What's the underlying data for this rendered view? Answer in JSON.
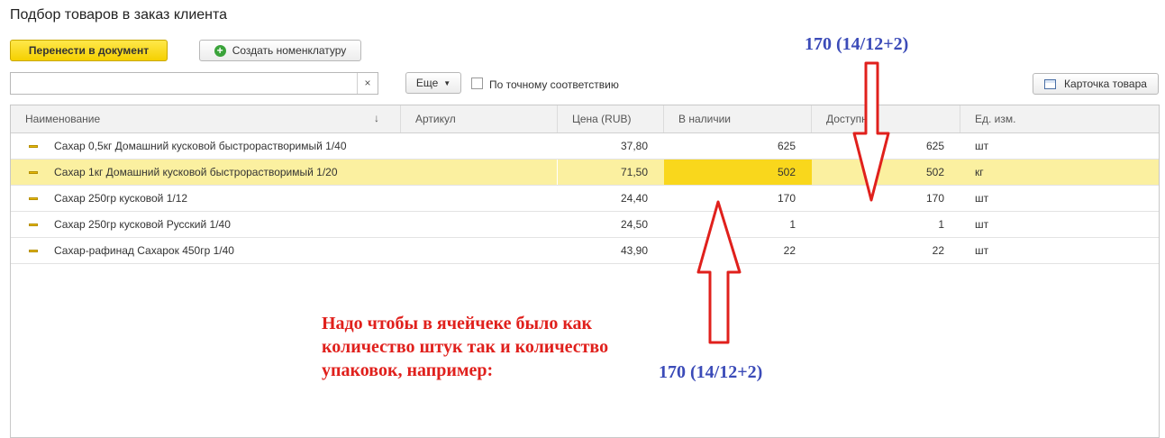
{
  "window": {
    "title": "Подбор товаров в заказ клиента"
  },
  "toolbar": {
    "transfer_label": "Перенести в документ",
    "create_label": "Создать номенклатуру",
    "more_label": "Еще",
    "exact_match_label": "По точному соответствию",
    "card_label": "Карточка товара"
  },
  "search": {
    "value": "",
    "placeholder": "",
    "clear_glyph": "×"
  },
  "table": {
    "columns": [
      "Наименование",
      "Артикул",
      "Цена (RUB)",
      "В наличии",
      "Доступно",
      "Ед. изм."
    ],
    "sort_glyph": "↓",
    "rows": [
      {
        "name": "Сахар 0,5кг Домашний кусковой быстрорастворимый 1/40",
        "article": "",
        "price": "37,80",
        "in_stock": "625",
        "available": "625",
        "unit": "шт"
      },
      {
        "name": "Сахар 1кг Домашний кусковой быстрорастворимый 1/20",
        "article": "",
        "price": "71,50",
        "in_stock": "502",
        "available": "502",
        "unit": "кг"
      },
      {
        "name": "Сахар 250гр кусковой 1/12",
        "article": "",
        "price": "24,40",
        "in_stock": "170",
        "available": "170",
        "unit": "шт"
      },
      {
        "name": "Сахар 250гр кусковой Русский 1/40",
        "article": "",
        "price": "24,50",
        "in_stock": "1",
        "available": "1",
        "unit": "шт"
      },
      {
        "name": "Сахар-рафинад Сахарок 450гр 1/40",
        "article": "",
        "price": "43,90",
        "in_stock": "22",
        "available": "22",
        "unit": "шт"
      }
    ],
    "selected_row": 1
  },
  "annotations": {
    "example_top": "170 (14/12+2)",
    "example_bottom": "170 (14/12+2)",
    "note_lines": [
      "Надо чтобы в ячейчеке было как",
      "количество штук так и количество",
      "упаковок, например:"
    ]
  },
  "colors": {
    "accent_yellow": "#f5d000",
    "selection": "#fbf0a0",
    "annotation_red": "#e0201c",
    "annotation_blue": "#3b4bb8"
  }
}
